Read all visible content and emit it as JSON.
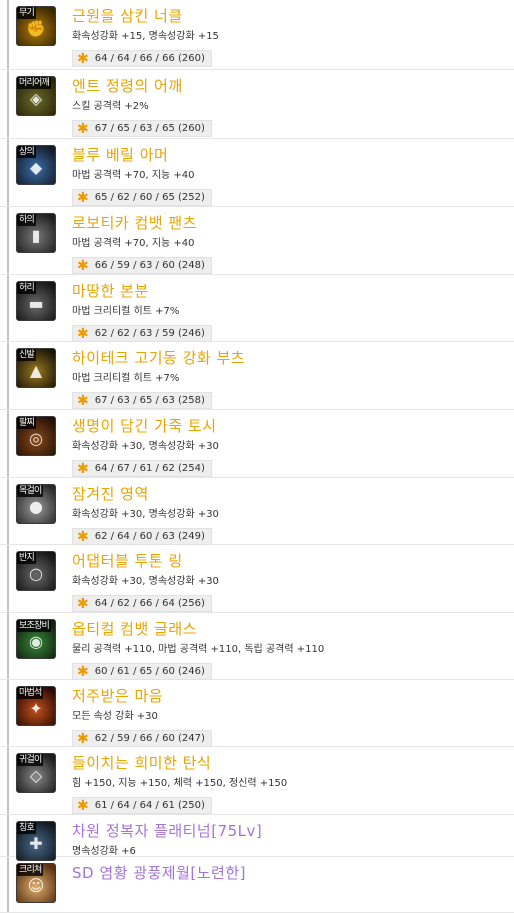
{
  "items": [
    {
      "slot": "무기",
      "name": "근원을 삼킨 너클",
      "option": "화속성강화 +15, 명속성강화 +15",
      "stats": "64 / 64 / 66 / 66 (260)",
      "color": "#e8a400",
      "icon": "knuckle-icon",
      "icon_bg": [
        "#b07c10",
        "#3a2600"
      ]
    },
    {
      "slot": "머리어깨",
      "name": "엔트 정령의 어깨",
      "option": "스킬 공격력 +2%",
      "stats": "67 / 65 / 63 / 65 (260)",
      "color": "#e8a400",
      "icon": "shoulder-armor-icon",
      "icon_bg": [
        "#6b6a2a",
        "#2a2408"
      ]
    },
    {
      "slot": "상의",
      "name": "블루 베릴 아머",
      "option": "마법 공격력 +70, 지능 +40",
      "stats": "65 / 62 / 60 / 65 (252)",
      "color": "#e8a400",
      "icon": "chest-armor-icon",
      "icon_bg": [
        "#3a6fa8",
        "#141a2a"
      ]
    },
    {
      "slot": "하의",
      "name": "로보티카 컴뱃 팬츠",
      "option": "마법 공격력 +70, 지능 +40",
      "stats": "66 / 59 / 63 / 60 (248)",
      "color": "#e8a400",
      "icon": "pants-icon",
      "icon_bg": [
        "#7a7a7a",
        "#1e1e1e"
      ]
    },
    {
      "slot": "허리",
      "name": "마땅한 본분",
      "option": "마법 크리티컬 히트 +7%",
      "stats": "62 / 62 / 63 / 59 (246)",
      "color": "#e8a400",
      "icon": "belt-icon",
      "icon_bg": [
        "#6a6a6a",
        "#151515"
      ]
    },
    {
      "slot": "신발",
      "name": "하이테크 고기동 강화 부츠",
      "option": "마법 크리티컬 히트 +7%",
      "stats": "67 / 63 / 65 / 63 (258)",
      "color": "#e8a400",
      "icon": "boots-icon",
      "icon_bg": [
        "#9a7a20",
        "#1a1406"
      ]
    },
    {
      "slot": "팔찌",
      "name": "생명이 담긴 가죽 토시",
      "option": "화속성강화 +30, 명속성강화 +30",
      "stats": "64 / 67 / 61 / 62 (254)",
      "color": "#e8a400",
      "icon": "bracelet-icon",
      "icon_bg": [
        "#8a4a1a",
        "#241006"
      ]
    },
    {
      "slot": "목걸이",
      "name": "잠겨진 영역",
      "option": "화속성강화 +30, 명속성강화 +30",
      "stats": "62 / 64 / 60 / 63 (249)",
      "color": "#e8a400",
      "icon": "necklace-icon",
      "icon_bg": [
        "#9a9a9a",
        "#2a2a2a"
      ]
    },
    {
      "slot": "반지",
      "name": "어댑터블 투톤 링",
      "option": "화속성강화 +30, 명속성강화 +30",
      "stats": "64 / 62 / 66 / 64 (256)",
      "color": "#e8a400",
      "icon": "ring-icon",
      "icon_bg": [
        "#6a6a6a",
        "#141414"
      ]
    },
    {
      "slot": "보조장비",
      "name": "옵티컬 컴뱃 글래스",
      "option": "물리 공격력 +110, 마법 공격력 +110, 독립 공격력 +110",
      "stats": "60 / 61 / 65 / 60 (246)",
      "color": "#e8a400",
      "icon": "glasses-icon",
      "icon_bg": [
        "#3a8a3a",
        "#0e200e"
      ]
    },
    {
      "slot": "마법석",
      "name": "저주받은 마음",
      "option": "모든 속성 강화 +30",
      "stats": "62 / 59 / 66 / 60 (247)",
      "color": "#e8a400",
      "icon": "magic-stone-icon",
      "icon_bg": [
        "#c4501a",
        "#2a0a04"
      ]
    },
    {
      "slot": "귀걸이",
      "name": "들이치는 희미한 탄식",
      "option": "힘 +150, 지능 +150, 체력 +150, 정신력 +150",
      "stats": "61 / 64 / 64 / 61 (250)",
      "color": "#e8a400",
      "icon": "earring-icon",
      "icon_bg": [
        "#8a8a8a",
        "#1a1a1a"
      ]
    },
    {
      "slot": "칭호",
      "name": "차원 정복자 플래티넘[75Lv]",
      "option": "명속성강화 +6",
      "stats": "",
      "color": "#a473d8",
      "icon": "title-icon",
      "icon_bg": [
        "#4a6a8a",
        "#101820"
      ]
    },
    {
      "slot": "크리쳐",
      "name": "SD 염황 광풍제월[노련한]",
      "option": "",
      "stats": "",
      "color": "#a473d8",
      "icon": "creature-icon",
      "icon_bg": [
        "#e0b070",
        "#5a3010"
      ]
    }
  ]
}
